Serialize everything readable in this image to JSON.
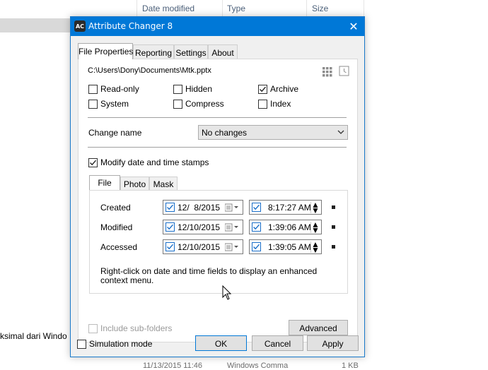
{
  "background": {
    "columns": [
      "Date modified",
      "Type",
      "Size"
    ],
    "partial_text": "ksimal dari Windo",
    "bottom_row": [
      "11/13/2015 11:46",
      "Windows Comma",
      "1 KB"
    ]
  },
  "dialog": {
    "title": "Attribute Changer 8",
    "app_icon_text": "AC",
    "close_symbol": "✕",
    "tabs": [
      "File Properties",
      "Reporting",
      "Settings",
      "About"
    ],
    "file_path": "C:\\Users\\Dony\\Documents\\Mtk.pptx",
    "attributes": [
      {
        "label": "Read-only",
        "checked": false
      },
      {
        "label": "Hidden",
        "checked": false
      },
      {
        "label": "Archive",
        "checked": true
      },
      {
        "label": "System",
        "checked": false
      },
      {
        "label": "Compress",
        "checked": false
      },
      {
        "label": "Index",
        "checked": false
      }
    ],
    "change_name_label": "Change name",
    "change_name_value": "No changes",
    "modify_dates_label": "Modify date and time stamps",
    "modify_dates_checked": true,
    "inner_tabs": [
      "File",
      "Photo",
      "Mask"
    ],
    "rows": [
      {
        "label": "Created",
        "date": "12/  8/2015",
        "time": "8:17:27 AM"
      },
      {
        "label": "Modified",
        "date": "12/10/2015",
        "time": "1:39:06 AM"
      },
      {
        "label": "Accessed",
        "date": "12/10/2015",
        "time": "1:39:05 AM"
      }
    ],
    "hint": "Right-click on date and time fields to display an enhanced context menu.",
    "include_subfolders_label": "Include sub-folders",
    "advanced_label": "Advanced",
    "simulation_label": "Simulation mode",
    "ok_label": "OK",
    "cancel_label": "Cancel",
    "apply_label": "Apply"
  },
  "colors": {
    "titlebar": "#0078d7",
    "checkbox_blue": "#1a6fc9"
  }
}
